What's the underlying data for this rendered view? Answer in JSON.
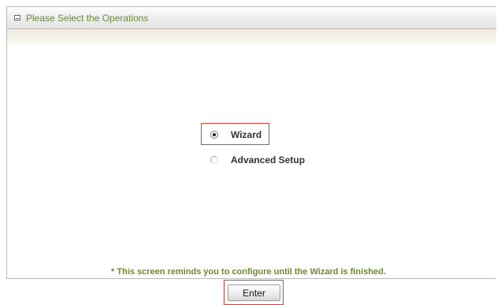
{
  "header": {
    "title": "Please Select the Operations",
    "icon": "panel-icon"
  },
  "options": [
    {
      "label": "Wizard",
      "selected": true
    },
    {
      "label": "Advanced Setup",
      "selected": false
    }
  ],
  "reminder_text": "* This screen reminds you to configure until the Wizard is finished.",
  "enter_label": "Enter",
  "colors": {
    "title_green": "#6a8a3a",
    "reminder_green": "#6c8a32",
    "highlight_red": "#e13b3b",
    "band_beige": "#efeadb"
  }
}
